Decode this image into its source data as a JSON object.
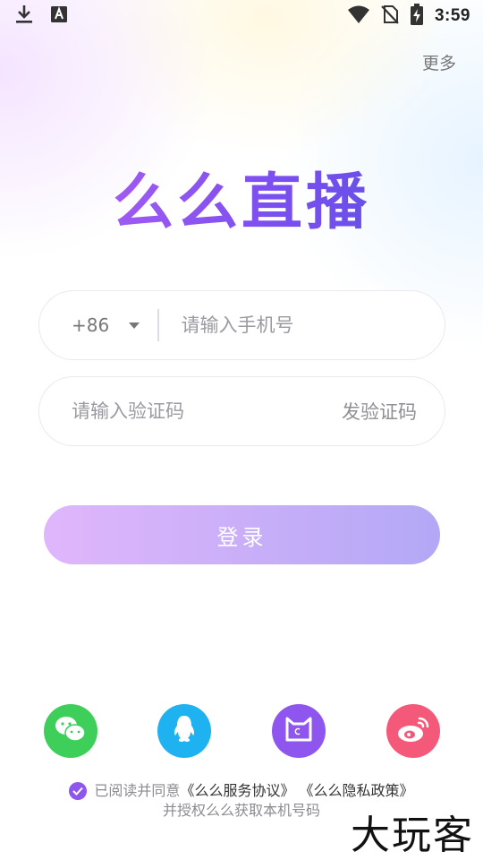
{
  "status_bar": {
    "time": "3:59",
    "icons": [
      "download-icon",
      "font-app-icon",
      "wifi-icon",
      "no-sim-icon",
      "battery-charging-icon"
    ]
  },
  "header": {
    "more_label": "更多"
  },
  "logo": {
    "text": "么么直播"
  },
  "phone_field": {
    "country_code": "+86",
    "placeholder": "请输入手机号",
    "value": ""
  },
  "code_field": {
    "placeholder": "请输入验证码",
    "value": "",
    "send_code_label": "发验证码"
  },
  "login": {
    "label": "登录"
  },
  "social_logins": [
    {
      "icon": "wechat-icon",
      "color": "#3dcf5a"
    },
    {
      "icon": "qq-icon",
      "color": "#1fb2f0"
    },
    {
      "icon": "cat-icon",
      "color": "#8e56ee"
    },
    {
      "icon": "weibo-icon",
      "color": "#f45979"
    }
  ],
  "agreement": {
    "checked": true,
    "prefix": "已阅读并同意",
    "service_link": "《么么服务协议》",
    "privacy_link": "《么么隐私政策》",
    "line2": "并授权么么获取本机号码"
  },
  "watermark": {
    "text": "大玩客"
  },
  "colors": {
    "accent": "#8e56ee",
    "login_start": "#e0b6fb",
    "login_end": "#b3a8f6"
  }
}
